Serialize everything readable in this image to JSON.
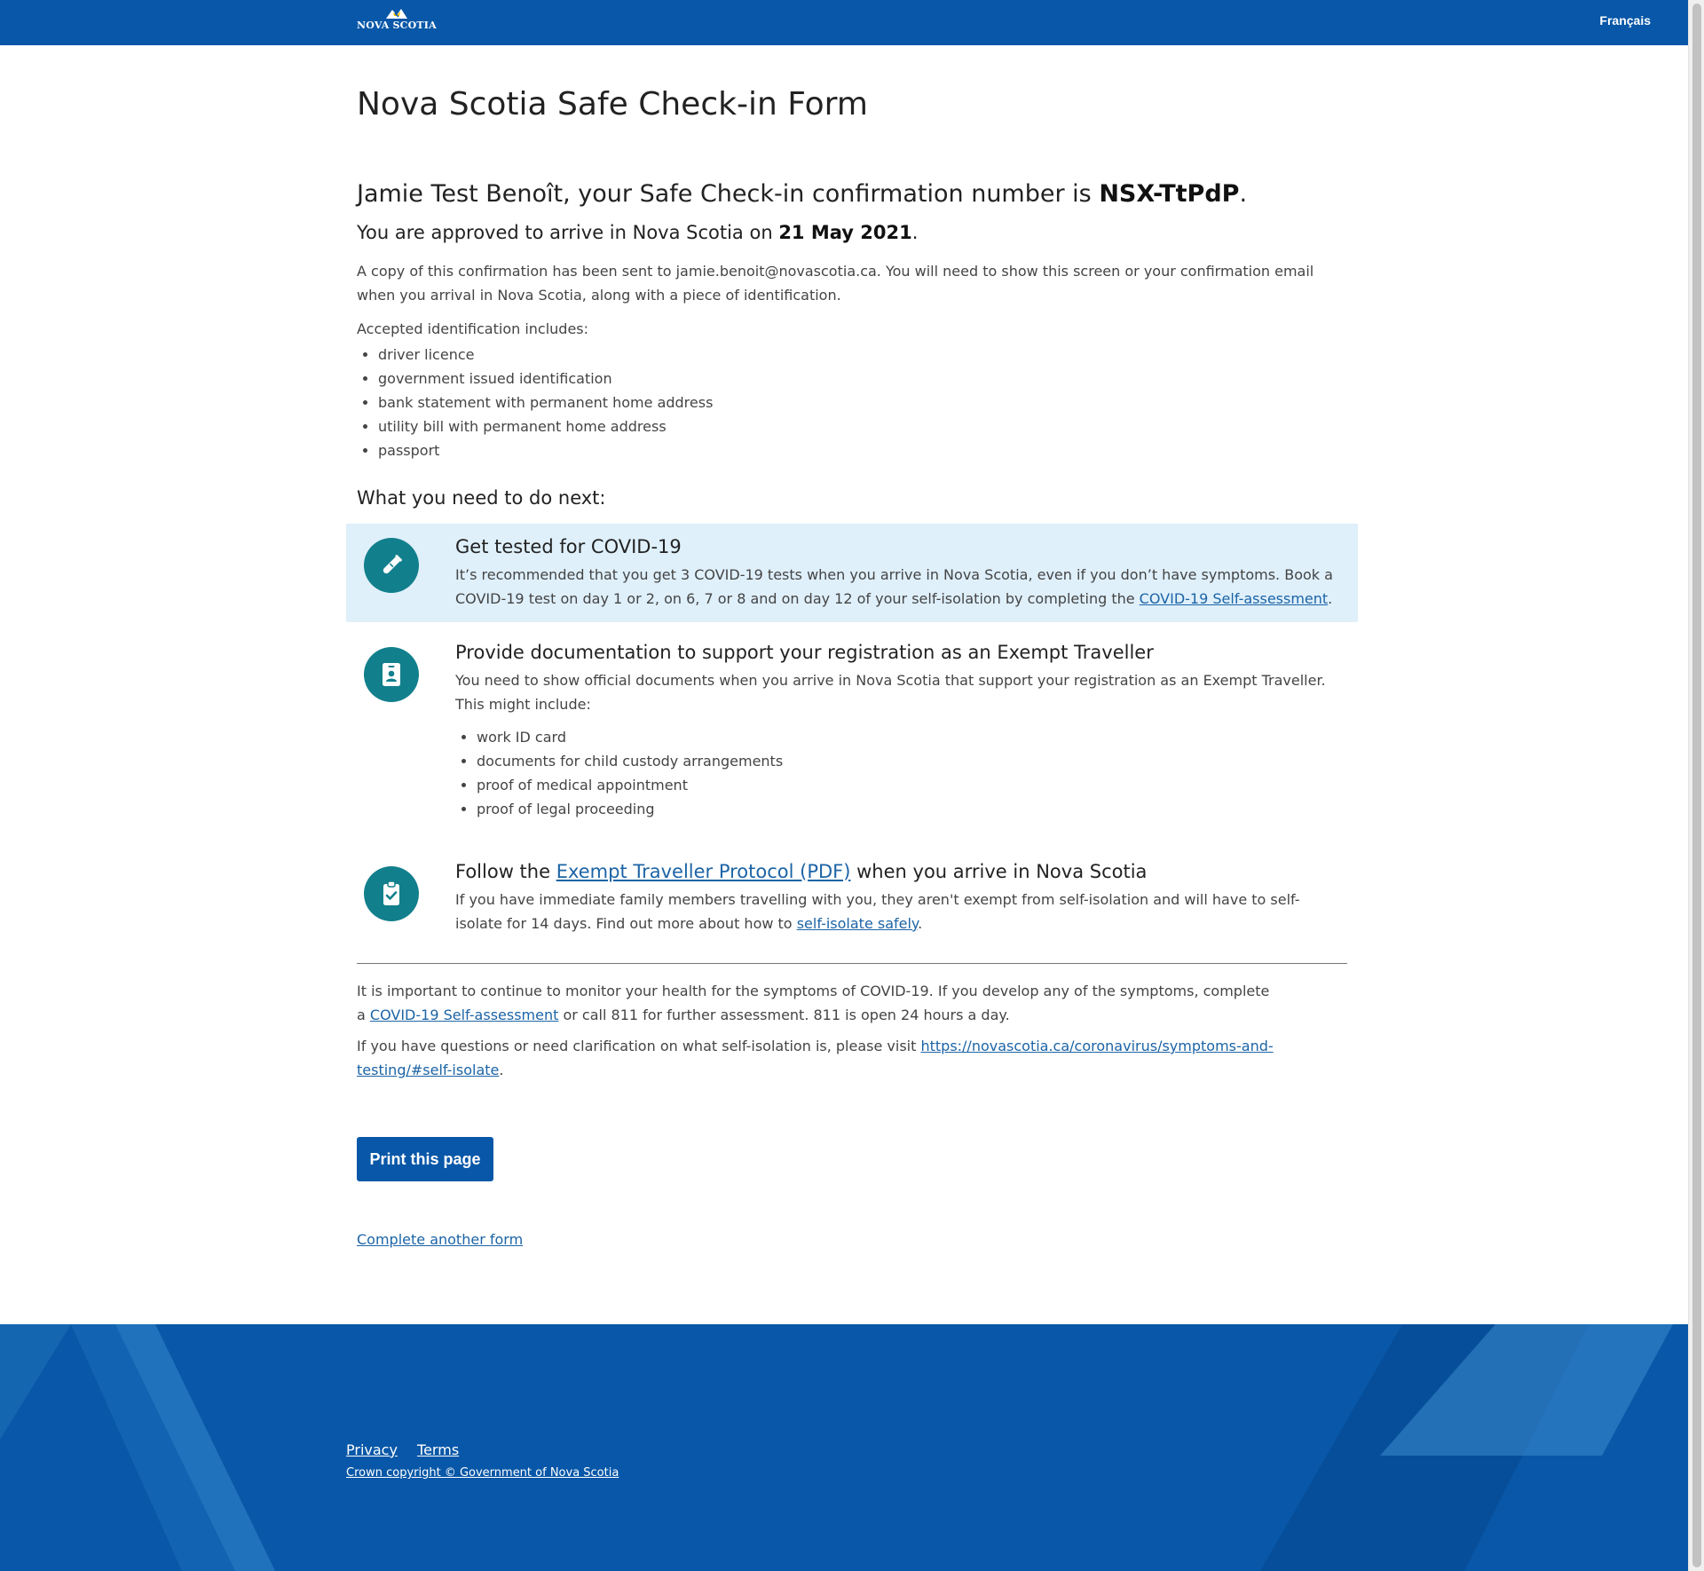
{
  "header": {
    "logo_text": "NOVA SCOTIA",
    "language_link": "Français"
  },
  "main": {
    "title": "Nova Scotia Safe Check-in Form",
    "confirmation": {
      "prefix": "Jamie Test Benoît, your Safe Check-in confirmation number is ",
      "number": "NSX-TtPdP",
      "suffix": "."
    },
    "approval": {
      "prefix": "You are approved to arrive in Nova Scotia on ",
      "date": "21 May 2021",
      "suffix": "."
    },
    "copy_text": "A copy of this confirmation has been sent to jamie.benoit@novascotia.ca. You will need to show this screen or your confirmation email when you arrival in Nova Scotia, along with a piece of identification.",
    "id_intro": "Accepted identification includes:",
    "id_items": [
      "driver licence",
      "government issued identification",
      "bank statement with permanent home address",
      "utility bill with permanent home address",
      "passport"
    ],
    "next_heading": "What you need to do next:",
    "steps": [
      {
        "icon": "test-tube-icon",
        "title": "Get tested for COVID-19",
        "text_before": "It’s recommended that you get 3 COVID-19 tests when you arrive in Nova Scotia, even if you don’t have symptoms. Book a COVID-19 test on day 1 or 2, on 6, 7 or 8 and on day 12 of your self-isolation by completing the ",
        "link": "COVID-19 Self-assessment",
        "text_after": "."
      },
      {
        "icon": "id-badge-icon",
        "title": "Provide documentation to support your registration as an Exempt Traveller",
        "text": "You need to show official documents when you arrive in Nova Scotia that support your registration as an Exempt Traveller. This might include:",
        "items": [
          "work ID card",
          "documents for child custody arrangements",
          "proof of medical appointment",
          "proof of legal proceeding"
        ]
      },
      {
        "icon": "clipboard-check-icon",
        "title_before": "Follow the ",
        "title_link": "Exempt Traveller Protocol (PDF)",
        "title_after": " when you arrive in Nova Scotia",
        "text_before": "If you have immediate family members travelling with you, they aren't exempt from self-isolation and will have to self-isolate for 14 days. Find out more about how to ",
        "link": "self-isolate safely",
        "text_after": "."
      }
    ],
    "monitor": {
      "before": "It is important to continue to monitor your health for the symptoms of COVID-19. If you develop any of the symptoms, complete a ",
      "link": "COVID-19 Self-assessment",
      "after": " or call 811 for further assessment. 811 is open 24 hours a day."
    },
    "questions": {
      "before": "If you have questions or need clarification on what self-isolation is, please visit ",
      "link": "https://novascotia.ca/coronavirus/symptoms-and-testing/#self-isolate",
      "after": "."
    },
    "print_button": "Print this page",
    "another_form_link": "Complete another form"
  },
  "footer": {
    "links": [
      "Privacy",
      "Terms"
    ],
    "copyright": "Crown copyright © Government of Nova Scotia"
  },
  "colors": {
    "brand_blue": "#0857a8",
    "highlight_bg": "#dff0fb",
    "icon_teal": "#127f8c",
    "link": "#1c64a6"
  }
}
